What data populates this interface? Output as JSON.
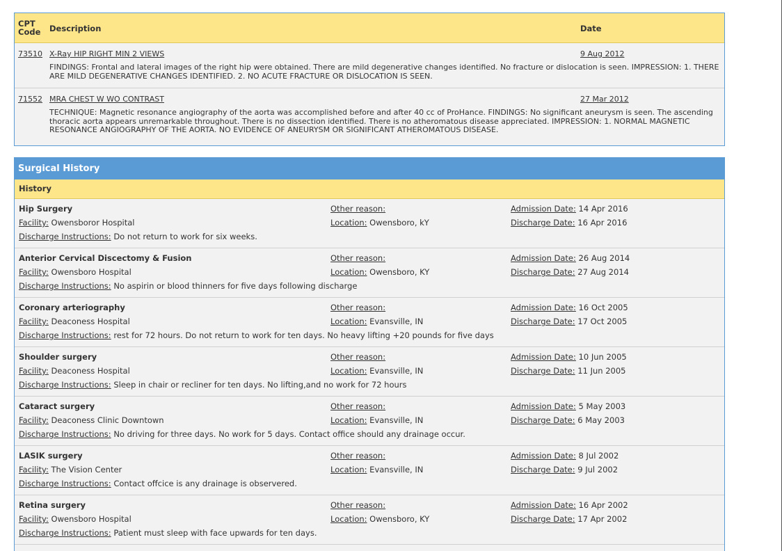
{
  "imaging": {
    "headers": {
      "cpt_code_line1": "CPT",
      "cpt_code_line2": "Code",
      "description": "Description",
      "date": "Date"
    },
    "rows": [
      {
        "code": "73510",
        "description": "X-Ray HIP RIGHT MIN 2 VIEWS",
        "date": "9 Aug 2012",
        "body": "FINDINGS:  Frontal and lateral images of the right hip were obtained.  There are mild  degenerative changes identified. No fracture or dislocation is seen. IMPRESSION:  1.   THERE ARE MILD DEGENERATIVE CHANGES IDENTIFIED.  2.   NO ACUTE FRACTURE OR DISLOCATION IS SEEN."
      },
      {
        "code": "71552",
        "description": "MRA CHEST W WO CONTRAST",
        "date": "27 Mar 2012",
        "body": "TECHNIQUE:   Magnetic resonance angiography of the aorta was accomplished before and after 40  cc of ProHance. FINDINGS:  No significant aneurysm is seen.  The ascending thoracic aorta appears unremarkable  throughout.  There is no dissection identified.  There is no atheromatous disease appreciated. IMPRESSION: 1.  NORMAL MAGNETIC RESONANCE ANGIOGRAPHY OF THE AORTA. NO EVIDENCE OF ANEURYSM OR SIGNIFICANT ATHEROMATOUS DISEASE."
      }
    ]
  },
  "surgical": {
    "title": "Surgical History",
    "subheader": "History",
    "labels": {
      "facility": "Facility:",
      "instructions": "Discharge Instructions:",
      "other_reason": "Other reason:",
      "location": "Location:",
      "admission": "Admission Date:",
      "discharge": "Discharge Date:"
    },
    "entries": [
      {
        "name": "Hip Surgery",
        "facility": "Owensboror Hospital",
        "instructions": "Do not return to work for six weeks.",
        "location": "Owensboro, kY",
        "admission": "14 Apr 2016",
        "discharge": "16 Apr 2016"
      },
      {
        "name": "Anterior Cervical Discectomy & Fusion",
        "facility": "Owensboro Hospital",
        "instructions": "No aspirin or blood thinners for five days following discharge",
        "location": "Owensboro, KY",
        "admission": "26 Aug 2014",
        "discharge": "27 Aug 2014"
      },
      {
        "name": "Coronary arteriography",
        "facility": "Deaconess Hospital",
        "instructions": "rest for 72 hours. Do not return to work for ten days. No heavy lifting +20 pounds for five days",
        "location": "Evansville, IN",
        "admission": "16 Oct 2005",
        "discharge": "17 Oct 2005"
      },
      {
        "name": "Shoulder surgery",
        "facility": "Deaconess Hospital",
        "instructions": "Sleep in chair or recliner for ten days. No lifting,and no work for 72 hours",
        "location": "Evansville, IN",
        "admission": "10 Jun 2005",
        "discharge": "11 Jun 2005"
      },
      {
        "name": "Cataract surgery",
        "facility": "Deaconess Clinic Downtown",
        "instructions": "No driving for three days. No work for 5 days. Contact office should any drainage occur.",
        "location": "Evansville, IN",
        "admission": "5 May 2003",
        "discharge": "6 May 2003"
      },
      {
        "name": "LASIK surgery",
        "facility": "The Vision Center",
        "instructions": "Contact offcice is any drainage is observered.",
        "location": "Evansville, IN",
        "admission": "8 Jul 2002",
        "discharge": "9 Jul 2002"
      },
      {
        "name": "Retina surgery",
        "facility": "Owensboro Hospital",
        "instructions": "Patient must sleep with face upwards for ten days.",
        "location": "Owensboro, KY",
        "admission": "16 Apr 2002",
        "discharge": "17 Apr 2002"
      }
    ]
  }
}
